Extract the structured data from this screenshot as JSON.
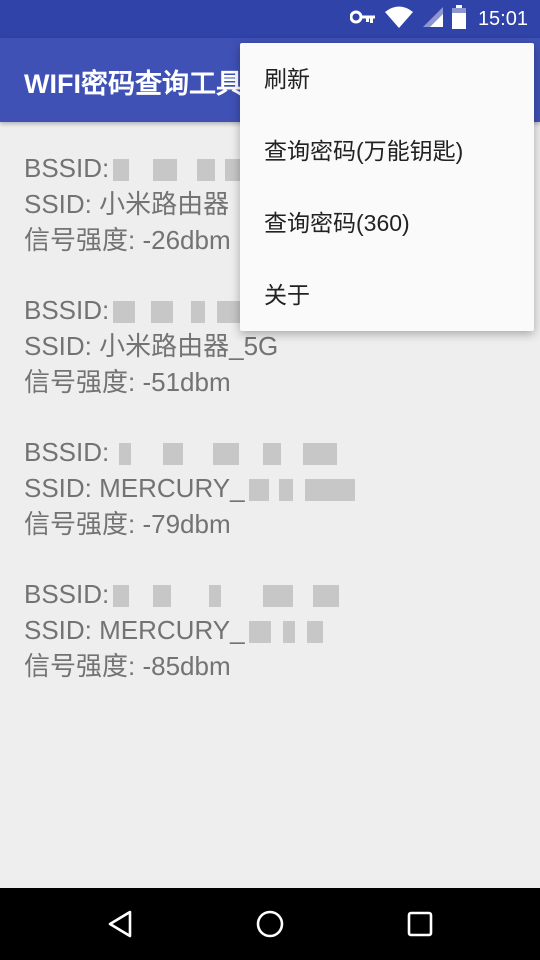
{
  "status_bar": {
    "time": "15:01",
    "icons": [
      "vpn-key-icon",
      "wifi-icon",
      "cell-signal-icon",
      "battery-icon"
    ]
  },
  "app_bar": {
    "title": "WIFI密码查询工具"
  },
  "wifi_list": [
    {
      "bssid_label": "BSSID:",
      "ssid_label": "SSID: 小米路由器",
      "signal_label": "信号强度: -26dbm"
    },
    {
      "bssid_label": "BSSID:",
      "ssid_label": "SSID: 小米路由器_5G",
      "signal_label": "信号强度: -51dbm"
    },
    {
      "bssid_label": "BSSID:",
      "ssid_label": "SSID: MERCURY_",
      "signal_label": "信号强度: -79dbm"
    },
    {
      "bssid_label": "BSSID:",
      "ssid_label": "SSID: MERCURY_",
      "signal_label": "信号强度: -85dbm"
    }
  ],
  "overflow_menu": {
    "items": [
      {
        "label": "刷新"
      },
      {
        "label": "查询密码(万能钥匙)"
      },
      {
        "label": "查询密码(360)"
      },
      {
        "label": "关于"
      }
    ]
  },
  "nav_bar": {
    "icons": [
      "back-icon",
      "home-icon",
      "recents-icon"
    ]
  },
  "colors": {
    "primary": "#3f51b5",
    "primary_dark": "#2f43a8",
    "background": "#eeeeee",
    "text": "#737373"
  }
}
